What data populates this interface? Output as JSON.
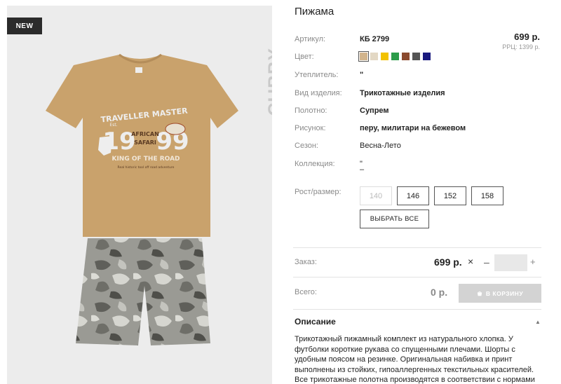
{
  "badge": "NEW",
  "brand_vertical": "CUBBY",
  "product": {
    "title": "Пижама",
    "price": "699 р.",
    "rrp": "РРЦ: 1399 р."
  },
  "specs": [
    {
      "label": "Артикул:",
      "value": "КБ 2799"
    },
    {
      "label": "Цвет:",
      "value": ""
    },
    {
      "label": "Утеплитель:",
      "value": "\""
    },
    {
      "label": "Вид изделия:",
      "value": "Трикотажные изделия"
    },
    {
      "label": "Полотно:",
      "value": "Супрем"
    },
    {
      "label": "Рисунок:",
      "value": "перу, милитари на бежевом"
    },
    {
      "label": "Сезон:",
      "value": "Весна-Лето"
    },
    {
      "label": "Коллекция:",
      "value": "\""
    }
  ],
  "collection_extra": "–",
  "colors": [
    "#d2b48c",
    "#e3d8c4",
    "#f2c200",
    "#2c9c4a",
    "#8b4a2f",
    "#555555",
    "#1a1a7e"
  ],
  "sizes": {
    "label": "Рост/размер:",
    "options": [
      "140",
      "146",
      "152",
      "158"
    ],
    "select_all": "ВЫБРАТЬ ВСЕ"
  },
  "order": {
    "label": "Заказ:",
    "price": "699 р.",
    "times": "×",
    "minus": "–",
    "plus": "+",
    "qty": ""
  },
  "total": {
    "label": "Всего:",
    "value": "0 р.",
    "cart_button": "В КОРЗИНУ"
  },
  "description": {
    "title": "Описание",
    "text": "Трикотажный пижамный комплект из натурального хлопка. У футболки короткие рукава со спущенными плечами. Шорты с удобным поясом на резинке. Оригинальная набивка и принт выполнены из стойких, гипоаллергенных текстильных красителей. Все трикотажные полотна производятся в соответствии с нормами"
  },
  "print": {
    "line1": "TRAVELLER MASTER",
    "est": "Est.",
    "num_left": "19",
    "num_right": "99",
    "mid1": "AFRICAN",
    "mid2": "SAFARI",
    "line3": "KING OF THE ROAD",
    "line4": "Real historic tool off road adventure"
  }
}
